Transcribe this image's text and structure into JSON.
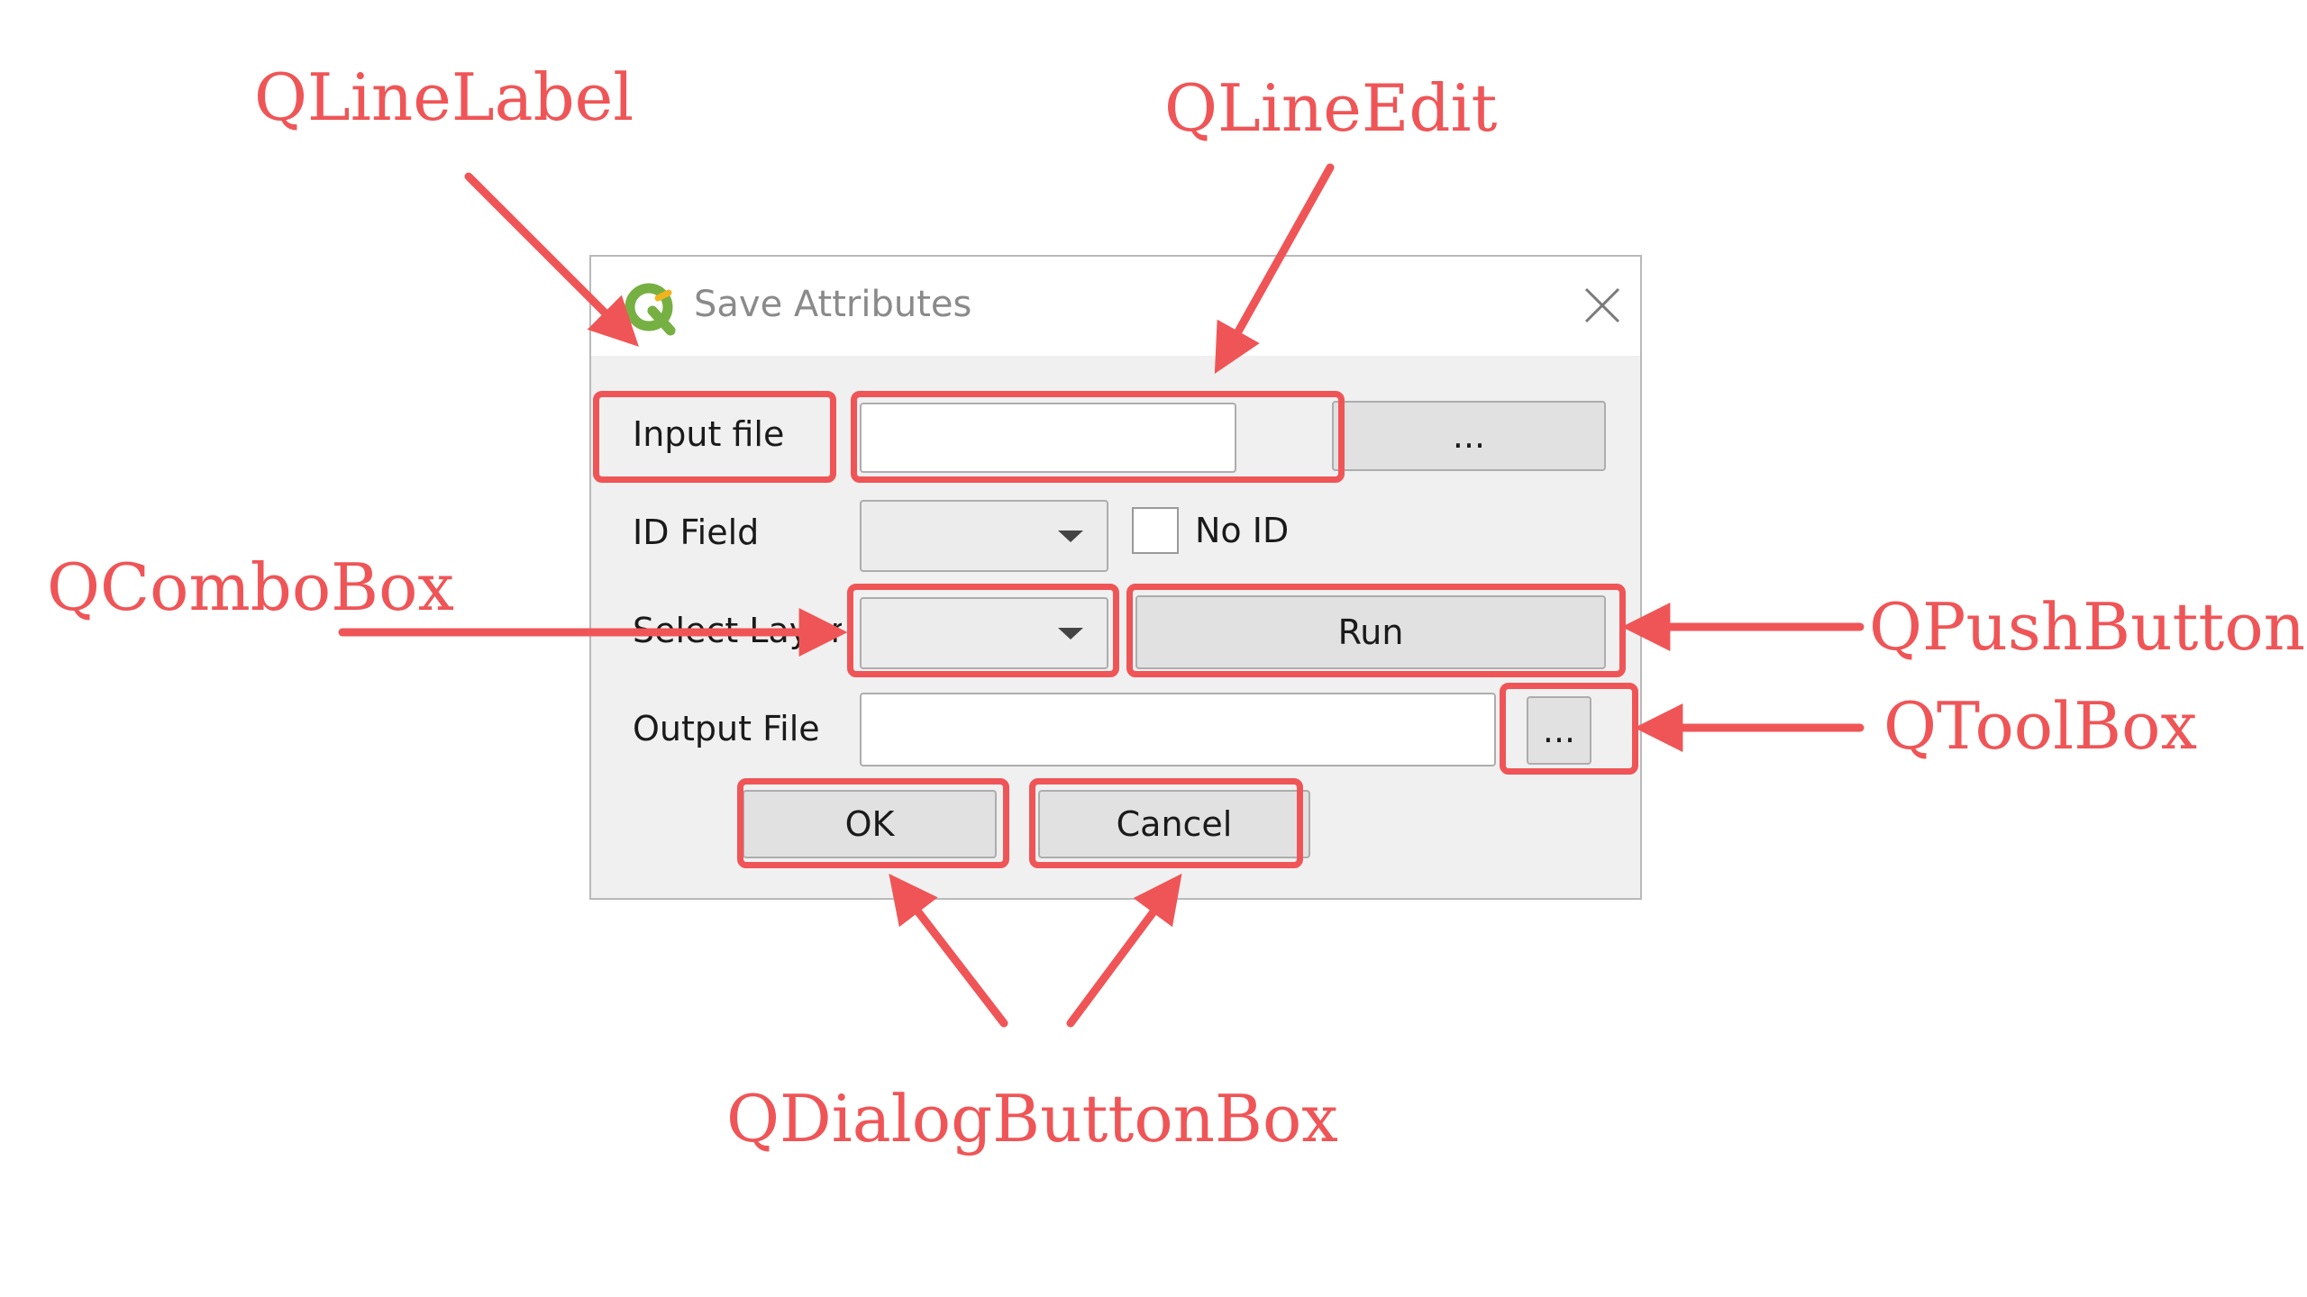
{
  "annotations": {
    "qlinelabel": "QLineLabel",
    "qlineedit": "QLineEdit",
    "qcombobox": "QComboBox",
    "qpushbutton": "QPushButton",
    "qtoolbox": "QToolBox",
    "qdialogbuttonbox": "QDialogButtonBox"
  },
  "colors": {
    "annotation": "#ef5557",
    "dialog_bg": "#f0f0f0",
    "logo_green": "#76b043"
  },
  "dialog": {
    "title": "Save Attributes",
    "app_icon": "qgis-logo-icon",
    "close_icon": "close-icon",
    "input_file_label": "Input file",
    "input_file_value": "",
    "browse_input_label": "...",
    "id_field_label": "ID Field",
    "id_field_value": "",
    "no_id_label": "No ID",
    "no_id_checked": false,
    "select_layer_label": "Select Layer",
    "select_layer_value": "",
    "run_label": "Run",
    "output_file_label": "Output File",
    "output_file_value": "",
    "browse_output_label": "...",
    "ok_label": "OK",
    "cancel_label": "Cancel"
  }
}
